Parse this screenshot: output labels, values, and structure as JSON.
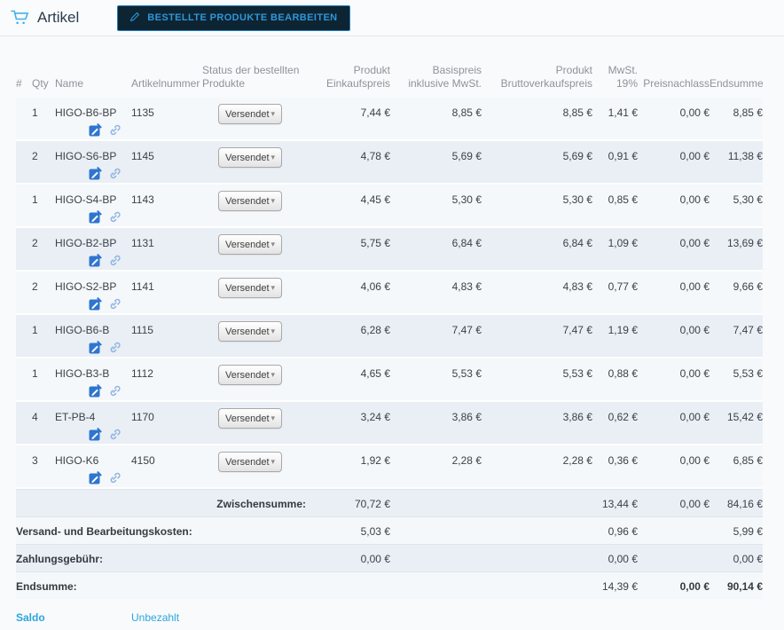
{
  "header": {
    "title": "Artikel",
    "edit_button_label": "BESTELLTE PRODUKTE BEARBEITEN"
  },
  "icons": {
    "cart": "shopping-cart-icon",
    "pencil": "pencil-icon",
    "open_product": "open-product-edit-icon",
    "link": "link-icon",
    "caret": "▾"
  },
  "colors": {
    "accent_blue": "#2aa5de",
    "button_bg": "#0d2433",
    "button_border": "#1f7fc0",
    "icon_edit_blue": "#2e75cf",
    "icon_link_blue": "#8fb3e2",
    "row_tint": "#e9eff4",
    "row_light": "#f5f8fa"
  },
  "table": {
    "columns": [
      "#",
      "Qty",
      "Name",
      "Artikelnummer",
      "Status der bestellten Produkte",
      "Produkt Einkaufspreis",
      "Basispreis inklusive MwSt.",
      "Produkt Bruttoverkaufspreis",
      "MwSt. 19%",
      "Preisnachlass",
      "Endsumme"
    ],
    "rows": [
      {
        "qty": "1",
        "name": "HIGO-B6-BP",
        "sku": "1135",
        "status": "Versendet",
        "purchase": "7,44 €",
        "base_incl": "8,85 €",
        "gross": "8,85 €",
        "tax": "1,41 €",
        "discount": "0,00 €",
        "total": "8,85 €"
      },
      {
        "qty": "2",
        "name": "HIGO-S6-BP",
        "sku": "1145",
        "status": "Versendet",
        "purchase": "4,78 €",
        "base_incl": "5,69 €",
        "gross": "5,69 €",
        "tax": "0,91 €",
        "discount": "0,00 €",
        "total": "11,38 €"
      },
      {
        "qty": "1",
        "name": "HIGO-S4-BP",
        "sku": "1143",
        "status": "Versendet",
        "purchase": "4,45 €",
        "base_incl": "5,30 €",
        "gross": "5,30 €",
        "tax": "0,85 €",
        "discount": "0,00 €",
        "total": "5,30 €"
      },
      {
        "qty": "2",
        "name": "HIGO-B2-BP",
        "sku": "1131",
        "status": "Versendet",
        "purchase": "5,75 €",
        "base_incl": "6,84 €",
        "gross": "6,84 €",
        "tax": "1,09 €",
        "discount": "0,00 €",
        "total": "13,69 €"
      },
      {
        "qty": "2",
        "name": "HIGO-S2-BP",
        "sku": "1141",
        "status": "Versendet",
        "purchase": "4,06 €",
        "base_incl": "4,83 €",
        "gross": "4,83 €",
        "tax": "0,77 €",
        "discount": "0,00 €",
        "total": "9,66 €"
      },
      {
        "qty": "1",
        "name": "HIGO-B6-B",
        "sku": "1115",
        "status": "Versendet",
        "purchase": "6,28 €",
        "base_incl": "7,47 €",
        "gross": "7,47 €",
        "tax": "1,19 €",
        "discount": "0,00 €",
        "total": "7,47 €"
      },
      {
        "qty": "1",
        "name": "HIGO-B3-B",
        "sku": "1112",
        "status": "Versendet",
        "purchase": "4,65 €",
        "base_incl": "5,53 €",
        "gross": "5,53 €",
        "tax": "0,88 €",
        "discount": "0,00 €",
        "total": "5,53 €"
      },
      {
        "qty": "4",
        "name": "ET-PB-4",
        "sku": "1170",
        "status": "Versendet",
        "purchase": "3,24 €",
        "base_incl": "3,86 €",
        "gross": "3,86 €",
        "tax": "0,62 €",
        "discount": "0,00 €",
        "total": "15,42 €"
      },
      {
        "qty": "3",
        "name": "HIGO-K6",
        "sku": "4150",
        "status": "Versendet",
        "purchase": "1,92 €",
        "base_incl": "2,28 €",
        "gross": "2,28 €",
        "tax": "0,36 €",
        "discount": "0,00 €",
        "total": "6,85 €"
      }
    ],
    "summary": [
      {
        "label": "Zwischensumme:",
        "purchase": "70,72 €",
        "tax": "13,44 €",
        "discount": "0,00 €",
        "total": "84,16 €"
      },
      {
        "label": "Versand- und Bearbeitungskosten:",
        "purchase": "5,03 €",
        "tax": "0,96 €",
        "discount": "",
        "total": "5,99 €"
      },
      {
        "label": "Zahlungsgebühr:",
        "purchase": "0,00 €",
        "tax": "0,00 €",
        "discount": "",
        "total": "0,00 €"
      },
      {
        "label": "Endsumme:",
        "purchase": "",
        "tax": "14,39 €",
        "discount": "0,00 €",
        "total": "90,14 €"
      }
    ],
    "saldo": {
      "label": "Saldo",
      "value": "Unbezahlt"
    }
  }
}
